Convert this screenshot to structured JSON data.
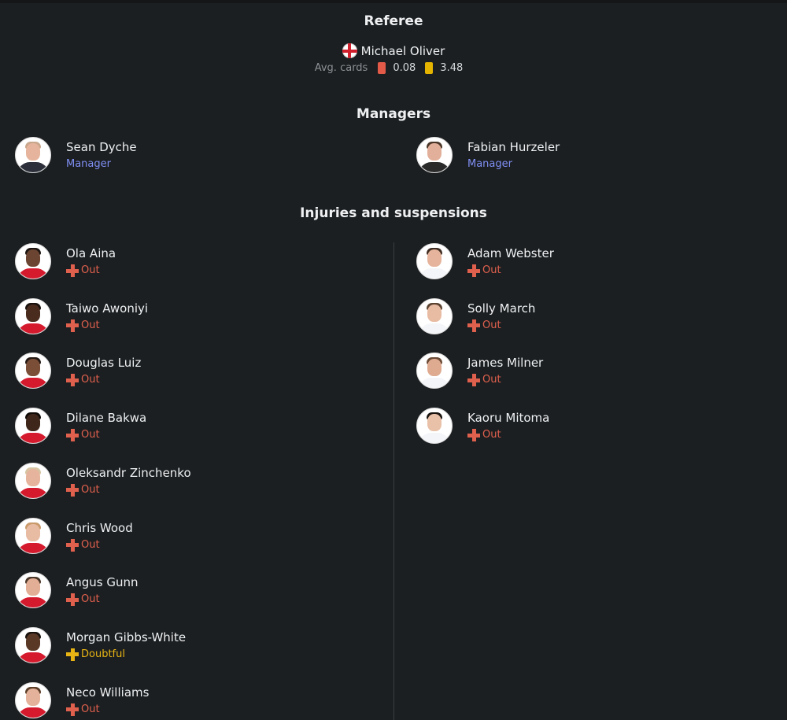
{
  "referee": {
    "title": "Referee",
    "name": "Michael Oliver",
    "flag_icon": "england-flag-icon",
    "avg_label": "Avg. cards",
    "red_cards": "0.08",
    "yellow_cards": "3.48",
    "colors": {
      "red": "#e45a49",
      "yellow": "#e4b400"
    }
  },
  "managers": {
    "title": "Managers",
    "home": {
      "name": "Sean Dyche",
      "role": "Manager"
    },
    "away": {
      "name": "Fabian Hurzeler",
      "role": "Manager"
    }
  },
  "injuries": {
    "title": "Injuries and suspensions",
    "home": [
      {
        "name": "Ola Aina",
        "status": "Out"
      },
      {
        "name": "Taiwo Awoniyi",
        "status": "Out"
      },
      {
        "name": "Douglas Luiz",
        "status": "Out"
      },
      {
        "name": "Dilane Bakwa",
        "status": "Out"
      },
      {
        "name": "Oleksandr Zinchenko",
        "status": "Out"
      },
      {
        "name": "Chris Wood",
        "status": "Out"
      },
      {
        "name": "Angus Gunn",
        "status": "Out"
      },
      {
        "name": "Morgan Gibbs-White",
        "status": "Doubtful"
      },
      {
        "name": "Neco Williams",
        "status": "Out"
      }
    ],
    "away": [
      {
        "name": "Adam Webster",
        "status": "Out"
      },
      {
        "name": "Solly March",
        "status": "Out"
      },
      {
        "name": "James Milner",
        "status": "Out"
      },
      {
        "name": "Kaoru Mitoma",
        "status": "Out"
      }
    ],
    "status_colors": {
      "Out": "#e0604e",
      "Doubtful": "#e7b414"
    },
    "status_icon": "plus-icon"
  }
}
